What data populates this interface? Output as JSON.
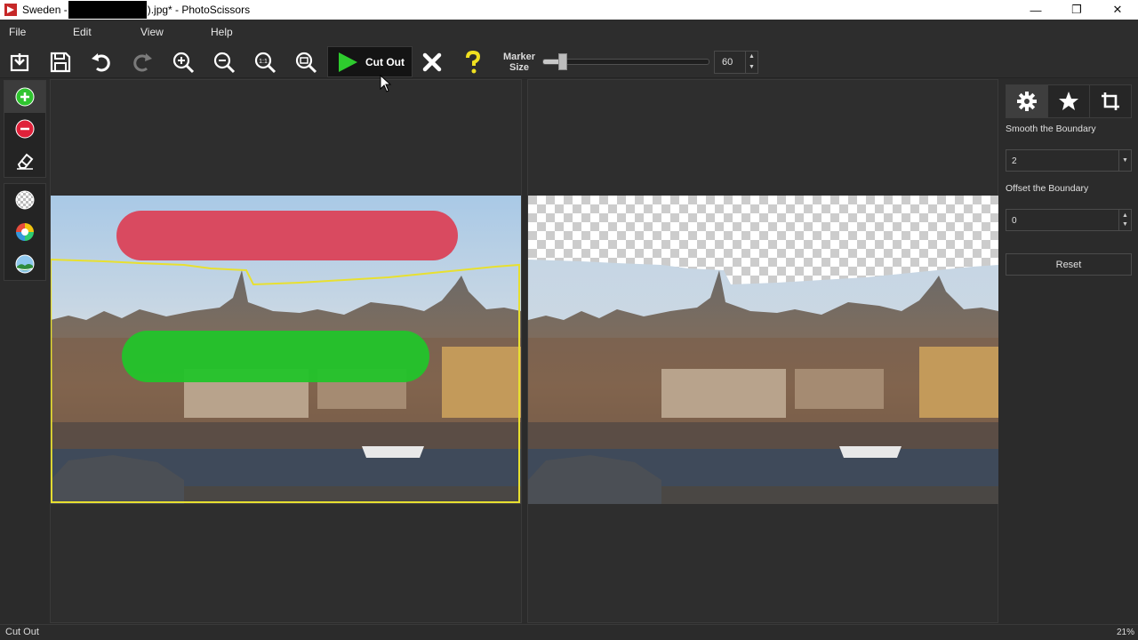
{
  "window": {
    "title_prefix": "Sweden -",
    "title_suffix": ").jpg* - PhotoScissors",
    "controls": {
      "minimize": "—",
      "restore": "❐",
      "close": "✕"
    }
  },
  "menu": {
    "items": [
      "File",
      "Edit",
      "View",
      "Help"
    ]
  },
  "toolbar": {
    "cutout_label": "Cut Out",
    "marker_label": "Marker Size",
    "marker_value": "60",
    "marker_fraction": 0.12,
    "icons": [
      "open-icon",
      "save-icon",
      "undo-icon",
      "redo-icon",
      "zoom-in-icon",
      "zoom-out-icon",
      "zoom-actual-icon",
      "zoom-fit-icon",
      "cancel-icon",
      "help-icon"
    ]
  },
  "tools": {
    "group1": [
      "foreground-marker-icon",
      "background-marker-icon",
      "eraser-icon"
    ],
    "group2": [
      "background-transparent-icon",
      "background-color-icon",
      "background-image-icon"
    ]
  },
  "right_panel": {
    "tabs": [
      "gear-icon",
      "star-icon",
      "crop-icon"
    ],
    "smooth_label": "Smooth the Boundary",
    "smooth_value": "2",
    "offset_label": "Offset the Boundary",
    "offset_value": "0",
    "reset_label": "Reset"
  },
  "status": {
    "left": "Cut Out",
    "zoom": "21%"
  },
  "colors": {
    "foreground_marker": "#22c42a",
    "background_marker": "#d94a60",
    "boundary": "#e8e030"
  }
}
